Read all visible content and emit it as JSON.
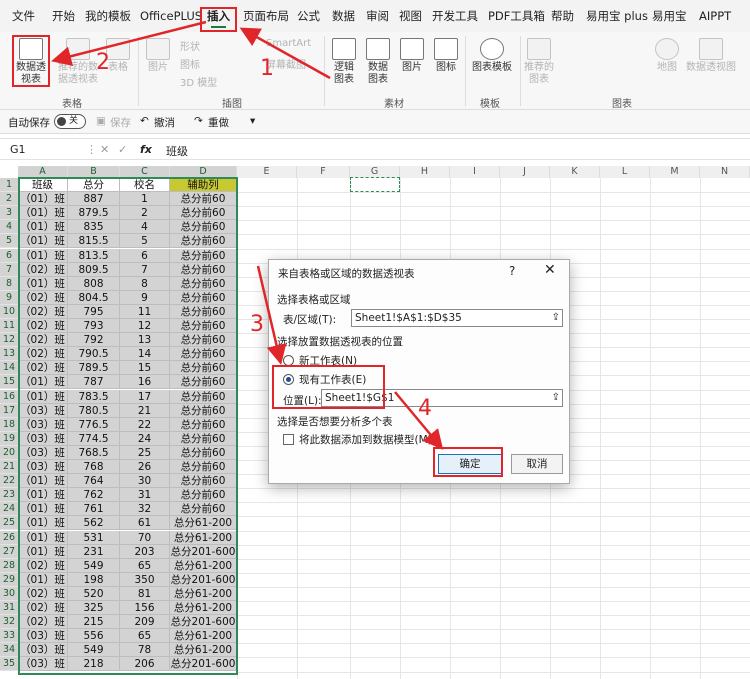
{
  "menu": [
    "文件",
    "开始",
    "我的模板",
    "OfficePLUS",
    "插入",
    "页面布局",
    "公式",
    "数据",
    "审阅",
    "视图",
    "开发工具",
    "PDF工具箱",
    "帮助",
    "易用宝 plus",
    "易用宝",
    "AIPPT"
  ],
  "ribbon": {
    "pivot_table": "数据透视表",
    "recommended_pivot": "推荐的数据透视表",
    "table": "表格",
    "picture": "图片",
    "shapes": "形状",
    "icons": "图标",
    "model_3d": "3D 模型",
    "smartart": "SmartArt",
    "screenshot": "屏幕截图",
    "logic_chart": "逻辑图表",
    "data_chart": "数据图表",
    "image_pic": "图片",
    "image_icon": "图标",
    "chart_template": "图表模板",
    "recommended_charts": "推荐的图表",
    "map": "地图",
    "pivot_chart": "数据透视图",
    "groups": {
      "tables": "表格",
      "illustrations": "插图",
      "material": "素材",
      "template": "模板",
      "charts": "图表"
    }
  },
  "qat": {
    "autosave": "自动保存",
    "toggle": "关",
    "save": "保存",
    "undo": "撤消",
    "redo": "重做"
  },
  "formula_bar": {
    "name_box": "G1",
    "fx": "fx",
    "content": "班级"
  },
  "columns": [
    "A",
    "B",
    "C",
    "D",
    "E",
    "F",
    "G",
    "H",
    "I",
    "J",
    "K",
    "L",
    "M",
    "N"
  ],
  "table": {
    "headers": [
      "班级",
      "总分",
      "校名",
      "辅助列"
    ],
    "rows": [
      [
        "（01）班",
        "887",
        "1",
        "总分前60"
      ],
      [
        "（01）班",
        "879.5",
        "2",
        "总分前60"
      ],
      [
        "（01）班",
        "835",
        "4",
        "总分前60"
      ],
      [
        "（01）班",
        "815.5",
        "5",
        "总分前60"
      ],
      [
        "（01）班",
        "813.5",
        "6",
        "总分前60"
      ],
      [
        "（02）班",
        "809.5",
        "7",
        "总分前60"
      ],
      [
        "（01）班",
        "808",
        "8",
        "总分前60"
      ],
      [
        "（02）班",
        "804.5",
        "9",
        "总分前60"
      ],
      [
        "（02）班",
        "795",
        "11",
        "总分前60"
      ],
      [
        "（02）班",
        "793",
        "12",
        "总分前60"
      ],
      [
        "（02）班",
        "792",
        "13",
        "总分前60"
      ],
      [
        "（02）班",
        "790.5",
        "14",
        "总分前60"
      ],
      [
        "（02）班",
        "789.5",
        "15",
        "总分前60"
      ],
      [
        "（01）班",
        "787",
        "16",
        "总分前60"
      ],
      [
        "（01）班",
        "783.5",
        "17",
        "总分前60"
      ],
      [
        "（03）班",
        "780.5",
        "21",
        "总分前60"
      ],
      [
        "（03）班",
        "776.5",
        "22",
        "总分前60"
      ],
      [
        "（03）班",
        "774.5",
        "24",
        "总分前60"
      ],
      [
        "（03）班",
        "768.5",
        "25",
        "总分前60"
      ],
      [
        "（03）班",
        "768",
        "26",
        "总分前60"
      ],
      [
        "（01）班",
        "764",
        "30",
        "总分前60"
      ],
      [
        "（01）班",
        "762",
        "31",
        "总分前60"
      ],
      [
        "（01）班",
        "761",
        "32",
        "总分前60"
      ],
      [
        "（01）班",
        "562",
        "61",
        "总分61-200"
      ],
      [
        "（01）班",
        "531",
        "70",
        "总分61-200"
      ],
      [
        "（01）班",
        "231",
        "203",
        "总分201-600"
      ],
      [
        "（02）班",
        "549",
        "65",
        "总分61-200"
      ],
      [
        "（01）班",
        "198",
        "350",
        "总分201-600"
      ],
      [
        "（02）班",
        "520",
        "81",
        "总分61-200"
      ],
      [
        "（02）班",
        "325",
        "156",
        "总分61-200"
      ],
      [
        "（02）班",
        "215",
        "209",
        "总分201-600"
      ],
      [
        "（03）班",
        "556",
        "65",
        "总分61-200"
      ],
      [
        "（03）班",
        "549",
        "78",
        "总分61-200"
      ],
      [
        "（03）班",
        "218",
        "206",
        "总分201-600"
      ]
    ]
  },
  "dialog": {
    "title": "来自表格或区域的数据透视表",
    "help": "?",
    "close": "✕",
    "section1": "选择表格或区域",
    "range_label": "表/区域(T):",
    "range_value": "Sheet1!$A$1:$D$35",
    "section2": "选择放置数据透视表的位置",
    "opt_new": "新工作表(N)",
    "opt_existing": "现有工作表(E)",
    "location_label": "位置(L):",
    "location_value": "Sheet1!$G$1",
    "section3": "选择是否想要分析多个表",
    "checkbox_label": "将此数据添加到数据模型(M)",
    "ok": "确定",
    "cancel": "取消"
  },
  "annotations": [
    "1",
    "2",
    "3",
    "4"
  ],
  "colors": {
    "accent": "#1b7a3f",
    "annotation": "#e0262a",
    "selection": "#2e8b57",
    "aux_header": "#c8c832"
  }
}
